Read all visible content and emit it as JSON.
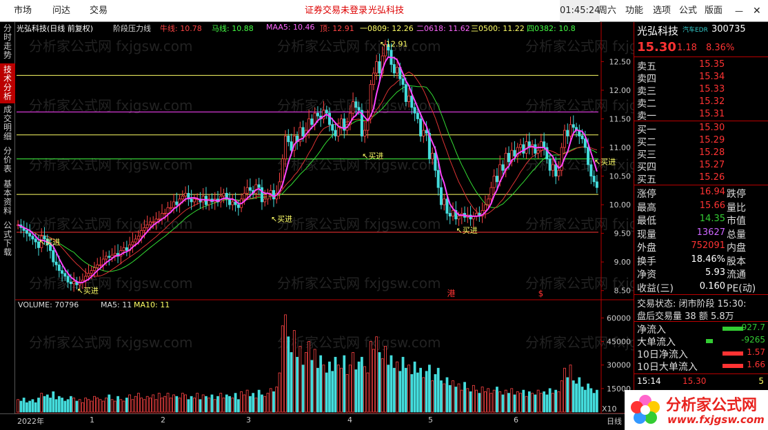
{
  "topbar": {
    "menu": [
      "市场",
      "问达",
      "交易"
    ],
    "status": "证券交易未登录",
    "stock": "光弘科技",
    "time": "01:45:24",
    "weekday": "周六",
    "right_menu": [
      "功能",
      "选项",
      "公式",
      "版面"
    ]
  },
  "leftnav": [
    "分时走势",
    "技术分析",
    "成交明细",
    "分价表",
    "基本资料",
    "公式下载"
  ],
  "info": {
    "name": "光弘科技(日线 前复权)",
    "indicator": "阶段压力线",
    "niu": "牛线: 10.78",
    "ma": "马线: 10.88",
    "maa5": "MAA5: 10.46",
    "ding": "顶: 12.91",
    "f0809": "一0809: 12.26",
    "f0618": "二0618: 11.62",
    "f0500": "三0500: 11.22",
    "f0382": "四0382: 10.8"
  },
  "volinfo": {
    "vol": "VOLUME: 70796",
    "ma5": "MA5: 11",
    "ma10": "MA10: 11"
  },
  "chart_data": {
    "type": "candlestick",
    "price_axis": [
      12.5,
      12.0,
      11.5,
      11.0,
      10.5,
      10.0,
      9.5,
      9.0,
      8.5
    ],
    "price_ylim": [
      8.4,
      12.95
    ],
    "volume_axis": [
      60000,
      45000,
      30000,
      15000
    ],
    "volume_ylim": [
      0,
      65000
    ],
    "x_ticks": [
      "2022年",
      "1",
      "2",
      "3",
      "4",
      "5",
      "6"
    ],
    "levels": [
      {
        "value": 12.26,
        "color": "#ffff66"
      },
      {
        "value": 11.62,
        "color": "#ff44ff"
      },
      {
        "value": 11.22,
        "color": "#ffff66"
      },
      {
        "value": 10.8,
        "color": "#44ff44"
      },
      {
        "value": 10.18,
        "color": "#ffff66"
      },
      {
        "value": 9.52,
        "color": "#ff3333"
      }
    ],
    "annotations": [
      {
        "text": "买进",
        "index": 8,
        "price": 9.45
      },
      {
        "text": "买进",
        "index": 21,
        "price": 8.6
      },
      {
        "text": "买进",
        "index": 87,
        "price": 9.85
      },
      {
        "text": "买进",
        "index": 118,
        "price": 10.95
      },
      {
        "text": "买进",
        "index": 150,
        "price": 9.65
      },
      {
        "text": "买进",
        "index": 197,
        "price": 10.85
      },
      {
        "text": "12.91",
        "index": 124,
        "price": 12.91
      }
    ],
    "marks": [
      {
        "text": "港",
        "index": 146
      },
      {
        "text": "$",
        "index": 177
      }
    ],
    "closes": [
      9.65,
      9.6,
      9.55,
      9.5,
      9.45,
      9.4,
      9.35,
      9.25,
      9.45,
      9.4,
      9.3,
      9.2,
      9.0,
      8.95,
      8.85,
      8.8,
      8.75,
      8.65,
      8.62,
      8.66,
      8.6,
      8.65,
      8.68,
      8.75,
      8.8,
      8.85,
      8.9,
      8.95,
      8.95,
      9.05,
      9.1,
      9.08,
      9.12,
      9.15,
      9.1,
      9.2,
      9.25,
      9.2,
      9.3,
      9.35,
      9.4,
      9.45,
      9.55,
      9.6,
      9.65,
      9.7,
      9.7,
      9.75,
      9.75,
      9.85,
      9.85,
      9.95,
      9.95,
      10.05,
      10.0,
      10.1,
      10.15,
      10.2,
      10.1,
      10.05,
      10.1,
      10.1,
      10.05,
      10.15,
      10.0,
      10.1,
      10.05,
      10.1,
      10.05,
      10.15,
      10.2,
      10.1,
      10.0,
      10.05,
      10.0,
      9.95,
      10.1,
      10.2,
      10.3,
      10.25,
      10.2,
      10.35,
      10.3,
      10.05,
      10.1,
      10.2,
      10.25,
      10.1,
      10.2,
      10.4,
      10.8,
      11.2,
      11.1,
      10.95,
      11.2,
      11.1,
      11.35,
      11.2,
      11.3,
      11.5,
      11.4,
      11.6,
      11.55,
      11.5,
      11.65,
      11.6,
      11.4,
      11.3,
      11.2,
      11.35,
      11.5,
      11.3,
      11.4,
      11.6,
      11.8,
      11.7,
      11.65,
      11.2,
      11.3,
      11.5,
      12.1,
      12.3,
      12.5,
      12.3,
      12.6,
      12.8,
      12.7,
      12.45,
      12.3,
      12.4,
      12.2,
      12.1,
      11.8,
      11.9,
      11.7,
      11.6,
      11.5,
      11.2,
      11.3,
      11.25,
      10.8,
      10.9,
      10.6,
      10.3,
      10.0,
      10.1,
      9.85,
      9.8,
      9.9,
      9.75,
      9.8,
      9.85,
      9.78,
      9.82,
      9.75,
      9.8,
      9.85,
      9.8,
      9.9,
      10.0,
      10.1,
      10.3,
      10.5,
      10.4,
      10.7,
      10.6,
      10.9,
      10.75,
      10.95,
      10.85,
      11.0,
      11.05,
      10.9,
      11.1,
      11.0,
      11.05,
      10.9,
      10.95,
      11.1,
      11.0,
      10.8,
      10.6,
      10.7,
      10.5,
      10.6,
      11.0,
      11.3,
      11.2,
      11.4,
      11.35,
      11.3,
      11.2,
      11.15,
      11.0,
      10.7,
      10.5,
      10.4,
      10.3
    ],
    "volumes": [
      8000,
      7000,
      9000,
      6000,
      7000,
      8000,
      6000,
      9000,
      12000,
      10000,
      11000,
      9000,
      13000,
      8000,
      10000,
      9000,
      7000,
      8000,
      10000,
      9000,
      7000,
      8000,
      6000,
      9000,
      8000,
      7000,
      10000,
      9000,
      8000,
      7000,
      9000,
      11000,
      8000,
      7000,
      10000,
      8000,
      7000,
      9000,
      11000,
      8000,
      10000,
      12000,
      9000,
      8000,
      10000,
      9000,
      11000,
      8000,
      12000,
      9000,
      10000,
      12000,
      9000,
      11000,
      10000,
      9000,
      12000,
      11000,
      8000,
      10000,
      9000,
      12000,
      8000,
      11000,
      10000,
      9000,
      11000,
      8000,
      10000,
      12000,
      9000,
      11000,
      10000,
      9000,
      12000,
      8000,
      13000,
      11000,
      14000,
      10000,
      12000,
      9000,
      14000,
      11000,
      10000,
      12000,
      15000,
      13000,
      16000,
      25000,
      55000,
      62000,
      48000,
      38000,
      52000,
      35000,
      42000,
      30000,
      38000,
      45000,
      33000,
      40000,
      28000,
      36000,
      30000,
      25000,
      32000,
      26000,
      35000,
      30000,
      28000,
      36000,
      24000,
      30000,
      38000,
      27000,
      32000,
      35000,
      29000,
      25000,
      45000,
      40000,
      48000,
      38000,
      34000,
      42000,
      30000,
      36000,
      28000,
      32000,
      26000,
      35000,
      28000,
      30000,
      24000,
      32000,
      25000,
      28000,
      22000,
      26000,
      30000,
      20000,
      24000,
      28000,
      20000,
      18000,
      22000,
      17000,
      20000,
      16000,
      18000,
      14000,
      19000,
      15000,
      13000,
      17000,
      14000,
      12000,
      16000,
      13000,
      15000,
      12000,
      14000,
      16000,
      13000,
      11000,
      14000,
      12000,
      15000,
      11000,
      13000,
      12000,
      14000,
      10000,
      13000,
      12000,
      11000,
      14000,
      12000,
      13000,
      11000,
      15000,
      12000,
      14000,
      13000,
      20000,
      28000,
      22000,
      30000,
      20000,
      18000,
      22000,
      16000,
      14000,
      18000,
      15000,
      12000,
      14000,
      11000,
      16000,
      13000,
      12000
    ]
  },
  "quote": {
    "name": "光弘科技",
    "tag": "汽车EDR",
    "code": "300735",
    "price": "15.30",
    "change": "1.18",
    "pct": "8.36%",
    "asks": [
      [
        "卖五",
        "15.35"
      ],
      [
        "卖四",
        "15.34"
      ],
      [
        "卖三",
        "15.33"
      ],
      [
        "卖二",
        "15.32"
      ],
      [
        "卖一",
        "15.31"
      ]
    ],
    "bids": [
      [
        "买一",
        "15.30"
      ],
      [
        "买二",
        "15.29"
      ],
      [
        "买三",
        "15.28"
      ],
      [
        "买四",
        "15.27"
      ],
      [
        "买五",
        "15.26"
      ]
    ],
    "stats": [
      [
        "涨停",
        "16.94",
        "跌停"
      ],
      [
        "最高",
        "15.66",
        "量比"
      ],
      [
        "最低",
        "14.35",
        "市值"
      ],
      [
        "现量",
        "13627",
        "总量"
      ],
      [
        "外盘",
        "752091",
        "内盘"
      ],
      [
        "换手",
        "18.46%",
        "股本"
      ],
      [
        "净资",
        "5.93",
        "流通"
      ],
      [
        "收益(三)",
        "0.160",
        "PE(动)"
      ]
    ],
    "trade_status": "交易状态: 闭市阶段 15:30:",
    "after_hours": "盘后交易量 38 额 5.8万",
    "flows": [
      [
        "净流入",
        "-927.7",
        "#33cc33"
      ],
      [
        "大单流入",
        "-9265",
        "#33cc33"
      ],
      [
        "10日净流入",
        "1.57",
        "#ff3333"
      ],
      [
        "10日大单流入",
        "1.66",
        "#ff3333"
      ]
    ],
    "last_tick": [
      "15:14",
      "15.30",
      "5"
    ]
  },
  "bottombar": {
    "x10": "X10",
    "period": "日线"
  },
  "logo": {
    "text": "分析家公式网",
    "url": "www.fxjgsw.com"
  },
  "watermark": "分析家公式网 fxjgsw.com"
}
